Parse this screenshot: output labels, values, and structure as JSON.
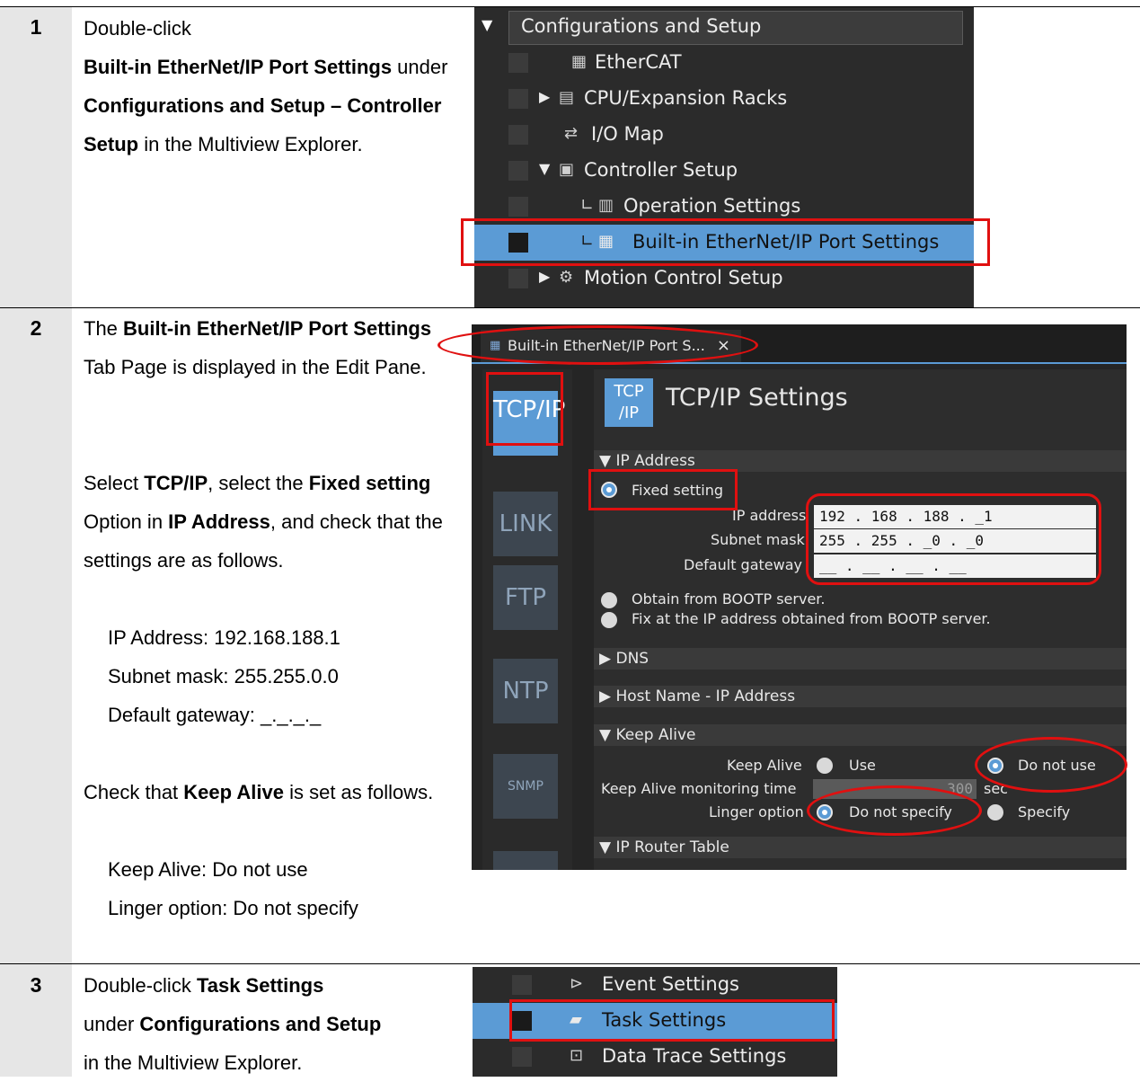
{
  "steps": [
    {
      "number": "1",
      "parts": [
        {
          "t": "Double-click ",
          "b": false
        },
        {
          "t": "Built-in EtherNet/IP Port Settings",
          "b": true
        },
        {
          "t": " under ",
          "b": false
        },
        {
          "t": "Configurations and Setup – Controller Setup",
          "b": true
        },
        {
          "t": " in the Multiview Explorer.",
          "b": false
        }
      ]
    },
    {
      "number": "2",
      "intro": [
        {
          "t": "The ",
          "b": false
        },
        {
          "t": "Built-in EtherNet/IP Port Settings",
          "b": true
        },
        {
          "t": " Tab Page is displayed in the Edit Pane.",
          "b": false
        }
      ],
      "select": [
        {
          "t": "Select ",
          "b": false
        },
        {
          "t": "TCP/IP",
          "b": true
        },
        {
          "t": ", select the ",
          "b": false
        },
        {
          "t": "Fixed setting",
          "b": true
        },
        {
          "t": " Option in ",
          "b": false
        },
        {
          "t": "IP Address",
          "b": true
        },
        {
          "t": ", and check that the settings are as follows.",
          "b": false
        }
      ],
      "settings": [
        "IP Address: 192.168.188.1",
        "Subnet mask: 255.255.0.0",
        "Default gateway: _._._._"
      ],
      "check": [
        {
          "t": "Check that ",
          "b": false
        },
        {
          "t": "Keep Alive",
          "b": true
        },
        {
          "t": " is set as follows.",
          "b": false
        }
      ],
      "keepalive": [
        "Keep Alive: Do not use",
        "Linger option: Do not specify"
      ]
    },
    {
      "number": "3",
      "parts": [
        {
          "t": "Double-click ",
          "b": false
        },
        {
          "t": "Task Settings",
          "b": true
        },
        {
          "t": " under ",
          "b": false
        },
        {
          "t": "Configurations and Setup",
          "b": true
        },
        {
          "t": " in the Multiview Explorer.",
          "b": false
        }
      ]
    }
  ],
  "tree1": {
    "root": "Configurations and Setup",
    "items": [
      "EtherCAT",
      "CPU/Expansion Racks",
      "I/O Map",
      "Controller Setup",
      "Operation Settings",
      "Built-in EtherNet/IP Port Settings",
      "Motion Control Setup"
    ]
  },
  "panel": {
    "tab_label": "Built-in EtherNet/IP Port S...",
    "tab_close": "×",
    "side_buttons": [
      "TCP/IP",
      "LINK",
      "FTP",
      "NTP",
      "SNMP"
    ],
    "title": "TCP/IP Settings",
    "sections": {
      "ip_address": "▼ IP Address",
      "dns": "▶ DNS",
      "host": "▶ Host Name - IP Address",
      "keep_alive": "▼ Keep Alive",
      "router": "▼ IP Router Table"
    },
    "fixed_setting": "Fixed setting",
    "ip_label": "IP address",
    "ip_value": "192 . 168 . 188 . _1",
    "mask_label": "Subnet mask",
    "mask_value": "255 . 255 . _0 . _0",
    "gw_label": "Default gateway",
    "gw_value": "__ . __ . __ . __",
    "bootp1": "Obtain from BOOTP server.",
    "bootp2": "Fix at the IP address obtained from BOOTP server.",
    "ka_label": "Keep Alive",
    "ka_use": "Use",
    "ka_notuse": "Do not use",
    "ka_time_label": "Keep Alive monitoring time",
    "ka_time_value": "300",
    "ka_time_unit": "sec",
    "linger_label": "Linger option",
    "linger_notspec": "Do not specify",
    "linger_spec": "Specify"
  },
  "tree3": {
    "items": [
      "Event Settings",
      "Task Settings",
      "Data Trace Settings"
    ]
  }
}
